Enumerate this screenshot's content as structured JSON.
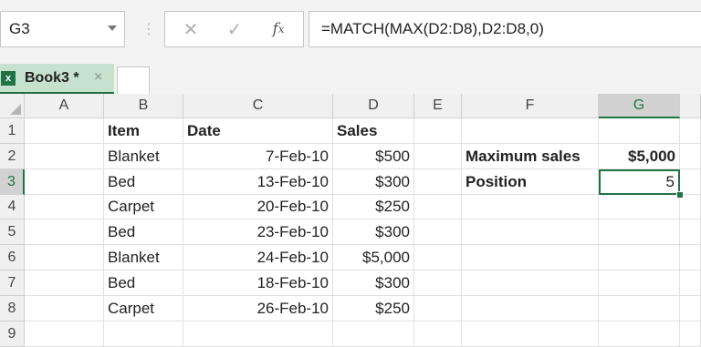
{
  "formula_bar": {
    "name_box": "G3",
    "formula": "=MATCH(MAX(D2:D8),D2:D8,0)",
    "icons": [
      "cancel-icon",
      "enter-check-icon",
      "insert-function-icon"
    ]
  },
  "workbook_tab": {
    "label": "Book3 *",
    "icon": "excel-icon",
    "close": "×"
  },
  "sheet": {
    "columns": [
      "A",
      "B",
      "C",
      "D",
      "E",
      "F",
      "G"
    ],
    "rows": [
      "1",
      "2",
      "3",
      "4",
      "5",
      "6",
      "7",
      "8",
      "9"
    ],
    "selected_cell": "G3",
    "cells": {
      "B1": "Item",
      "C1": "Date",
      "D1": "Sales",
      "B2": "Blanket",
      "C2": "7-Feb-10",
      "D2": "$500",
      "F2": "Maximum sales",
      "G2": "$5,000",
      "B3": "Bed",
      "C3": "13-Feb-10",
      "D3": "$300",
      "F3": "Position",
      "G3": "5",
      "B4": "Carpet",
      "C4": "20-Feb-10",
      "D4": "$250",
      "B5": "Bed",
      "C5": "23-Feb-10",
      "D5": "$300",
      "B6": "Blanket",
      "C6": "24-Feb-10",
      "D6": "$5,000",
      "B7": "Bed",
      "C7": "18-Feb-10",
      "D7": "$300",
      "B8": "Carpet",
      "C8": "26-Feb-10",
      "D8": "$250"
    },
    "accent_color": "#217346"
  }
}
